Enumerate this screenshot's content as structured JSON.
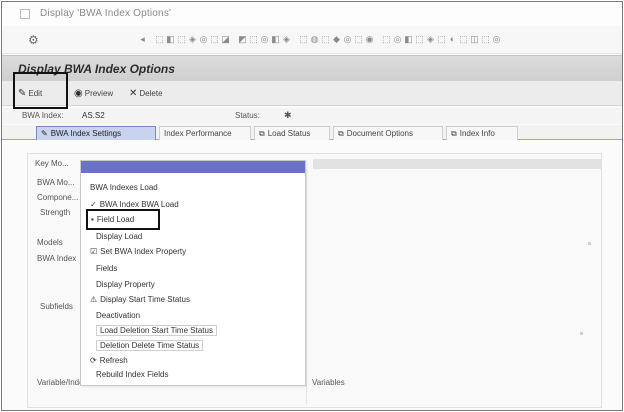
{
  "window": {
    "title": "Display 'BWA Index Options'"
  },
  "sys_toolbar": {
    "menu_glyph": "⚙",
    "icons": [
      "◂",
      "⬚",
      "◧",
      "⬚",
      "◈",
      "◎",
      "⬚",
      "◪",
      "◩",
      "⬚",
      "◎",
      "◧",
      "◈",
      "⬚",
      "◍",
      "⬚",
      "◆",
      "◎",
      "⬚",
      "◉",
      "⬚",
      "◎",
      "◧",
      "⬚",
      "◈",
      "⬚",
      "◐",
      "⬚",
      "◫",
      "⬚",
      "◎"
    ]
  },
  "screen": {
    "title": "Display BWA Index Options"
  },
  "app_toolbar": {
    "edit_label": "Edit",
    "preview_label": "Preview",
    "delete_label": "Delete"
  },
  "field_row": {
    "bwa_index_label": "BWA Index:",
    "bwa_index_value": "AS.S2",
    "status_label": "Status:"
  },
  "tabs": [
    {
      "label": "BWA Index Settings",
      "icon": "✎"
    },
    {
      "label": "Index Performance",
      "icon": ""
    },
    {
      "label": "Load Status",
      "icon": "⧉"
    },
    {
      "label": "Document Options",
      "icon": "⧉"
    },
    {
      "label": "Index Info",
      "icon": "⧉"
    }
  ],
  "left_labels": [
    {
      "text": "Key Mo..."
    },
    {
      "text": "BWA Mo..."
    },
    {
      "text": "Compone..."
    },
    {
      "text": "Strength"
    },
    {
      "text": "Models"
    },
    {
      "text": "BWA Index"
    },
    {
      "text": "Subfields"
    },
    {
      "text": "Variable/Index"
    }
  ],
  "right_label": "Variables",
  "menu": {
    "items": [
      {
        "label": "BWA Indexes Load",
        "icon": ""
      },
      {
        "label": "BWA Index BWA Load",
        "icon": "✓"
      },
      {
        "label": "Field Load",
        "icon": "▪"
      },
      {
        "label": "Display Load",
        "icon": ""
      },
      {
        "label": "Set BWA Index Property",
        "icon": "☑"
      },
      {
        "label": "Fields",
        "icon": ""
      },
      {
        "label": "Display Property",
        "icon": ""
      },
      {
        "label": "Display Start Time Status",
        "icon": "⚠"
      },
      {
        "label": "Deactivation",
        "icon": ""
      },
      {
        "label": "Load Deletion Start Time Status",
        "icon": ""
      },
      {
        "label": "Deletion Delete Time Status",
        "icon": ""
      },
      {
        "label": "Refresh",
        "icon": "⟳"
      },
      {
        "label": "Rebuild Index Fields",
        "icon": ""
      }
    ]
  }
}
